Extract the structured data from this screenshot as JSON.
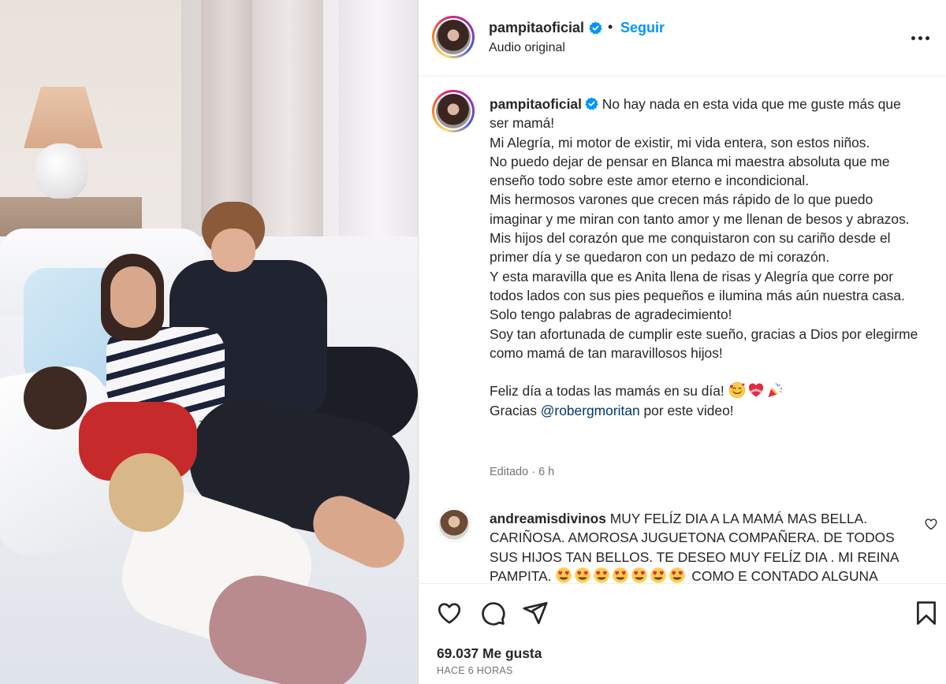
{
  "post": {
    "username": "pampitaoficial",
    "follow_label": "Seguir",
    "separator": "•",
    "audio_label": "Audio original"
  },
  "caption": {
    "username": "pampitaoficial",
    "text_before": " No hay nada en esta vida que me guste más que ser mamá!\nMi Alegría, mi motor de existir, mi vida entera, son estos niños.\nNo puedo dejar de pensar en Blanca mi maestra absoluta que me enseño todo sobre este amor eterno e incondicional.\nMis hermosos varones que crecen más rápido de lo que puedo imaginar y me miran con tanto amor y me llenan de besos y abrazos.\nMis hijos del corazón que me conquistaron con su cariño desde el primer día y se quedaron con un pedazo de mi corazón.\nY esta maravilla que es Anita llena de risas y Alegría que corre por todos lados con sus pies pequeños e ilumina más aún nuestra casa.\nSolo tengo palabras de agradecimiento!\nSoy tan afortunada de cumplir este sueño, gracias a Dios por elegirme como mamá de tan maravillosos hijos!\n\nFeliz día a todas las mamás en su día! ",
    "emojis": [
      "smiling-face-with-hearts-emoji",
      "heart-with-ribbon-emoji",
      "party-popper-emoji"
    ],
    "text_thanks": "\nGracias ",
    "mention": "@robergmoritan",
    "text_after": " por este video!",
    "edited_label": "Editado · 6 h"
  },
  "comments": [
    {
      "username": "andreamisdivinos",
      "text_before": " MUY FELÍZ DIA A LA MAMÁ MAS BELLA. CARIÑOSA. AMOROSA JUGUETONA COMPAÑERA. DE TODOS SUS HIJOS TAN BELLOS. TE DESEO MUY FELÍZ DIA . MI REINA PAMPITA. ",
      "emoji_repeat": "heart-eyes-emoji",
      "emoji_count": 7,
      "text_after": " COMO E CONTADO ALGUNA"
    }
  ],
  "actions": {
    "icons": [
      "heart-icon",
      "comment-icon",
      "share-icon",
      "save-icon"
    ],
    "likes": "69.037 Me gusta",
    "time": "HACE 6 HORAS"
  },
  "colors": {
    "link": "#0095f6",
    "mention": "#00376b",
    "muted": "#737373",
    "text": "#262626"
  }
}
